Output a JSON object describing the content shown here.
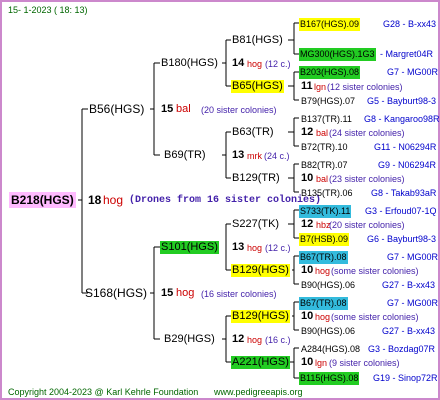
{
  "header": {
    "date": "15-   1-2023 (  18:  13)"
  },
  "footer": {
    "copyright": "Copyright 2004-2023 @ Karl Kehrle Foundation",
    "url": "www.pedigreeapis.org"
  },
  "colors": {
    "border": "#cc88cc",
    "root_bg": "#ffbbff",
    "yellow": "#ffff00",
    "green": "#22cc22",
    "blue": "#33bbdd",
    "light_green": "#99ffdd"
  },
  "root": {
    "name": "B218(HGS)",
    "gen": "18",
    "place": "hog",
    "note": "(Drones from 16 sister colonies)"
  },
  "g1": [
    {
      "name": "B56(HGS)",
      "gen": "15",
      "place": "bal",
      "note": "(20 sister colonies)"
    },
    {
      "name": "S168(HGS)",
      "gen": "15",
      "place": "hog",
      "note": "(16 sister colonies)"
    }
  ],
  "g2": [
    {
      "name": "B180(HGS)",
      "gen": "",
      "place": "",
      "note": ""
    },
    {
      "name": "B69(TR)",
      "gen": "13",
      "place": "mrk",
      "note": "(24 c.)"
    },
    {
      "name": "S101(HGS)",
      "gen": "13",
      "place": "hog",
      "note": "(12 c.)"
    },
    {
      "name": "B29(HGS)",
      "gen": "12",
      "place": "hog",
      "note": "(16 c.)"
    }
  ],
  "g3": [
    {
      "name": "B81(HGS)",
      "gen": "14",
      "place": "hog",
      "note": "(12 c.)"
    },
    {
      "name": "B65(HGS)",
      "gen": "11",
      "place": "lgn",
      "note": "(12 sister colonies)"
    },
    {
      "name": "B63(TR)",
      "gen": "12",
      "place": "bal",
      "note": "(24 sister colonies)"
    },
    {
      "name": "B129(TR)",
      "gen": "10",
      "place": "bal",
      "note": "(23 sister colonies)"
    },
    {
      "name": "S227(TK)",
      "gen": "12",
      "place": "hbz",
      "note": "(20 sister colonies)"
    },
    {
      "name": "B129(HGS)",
      "gen": "10",
      "place": "hog",
      "note": "(some sister colonies)"
    },
    {
      "name": "B129(HGS)",
      "gen": "10",
      "place": "hog",
      "note": "(some sister colonies)"
    },
    {
      "name": "A221(HGS)",
      "gen": "10",
      "place": "lgn",
      "note": "(9 sister colonies)"
    }
  ],
  "g4": [
    {
      "name": "B167(HGS).09",
      "ref": "G28 - B-xx43"
    },
    {
      "name": "MG300(HGS).1G3",
      "ref": "- Margret04R"
    },
    {
      "name": "B203(HGS).08",
      "ref": "G7 - MG00R"
    },
    {
      "name": "B79(HGS).07",
      "ref": "G5 - Bayburt98-3"
    },
    {
      "name": "B137(TR).11",
      "ref": "G8 - Kangaroo98R"
    },
    {
      "name": "B72(TR).10",
      "ref": "G11 - N06294R"
    },
    {
      "name": "B82(TR).07",
      "ref": "G9 - N06294R"
    },
    {
      "name": "B135(TR).06",
      "ref": "G8 - Takab93aR"
    },
    {
      "name": "S733(TK).11",
      "ref": "G3 - Erfoud07-1Q"
    },
    {
      "name": "B7(HSB).09",
      "ref": "G6 - Bayburt98-3"
    },
    {
      "name": "B67(TR).08",
      "ref": "G7 - MG00R"
    },
    {
      "name": "B90(HGS).06",
      "ref": "G27 - B-xx43"
    },
    {
      "name": "B67(TR).08",
      "ref": "G7 - MG00R"
    },
    {
      "name": "B90(HGS).06",
      "ref": "G27 - B-xx43"
    },
    {
      "name": "A284(HGS).08",
      "ref": "G3 - Bozdag07R"
    },
    {
      "name": "B115(HGS).08",
      "ref": "G19 - Sinop72R"
    }
  ]
}
